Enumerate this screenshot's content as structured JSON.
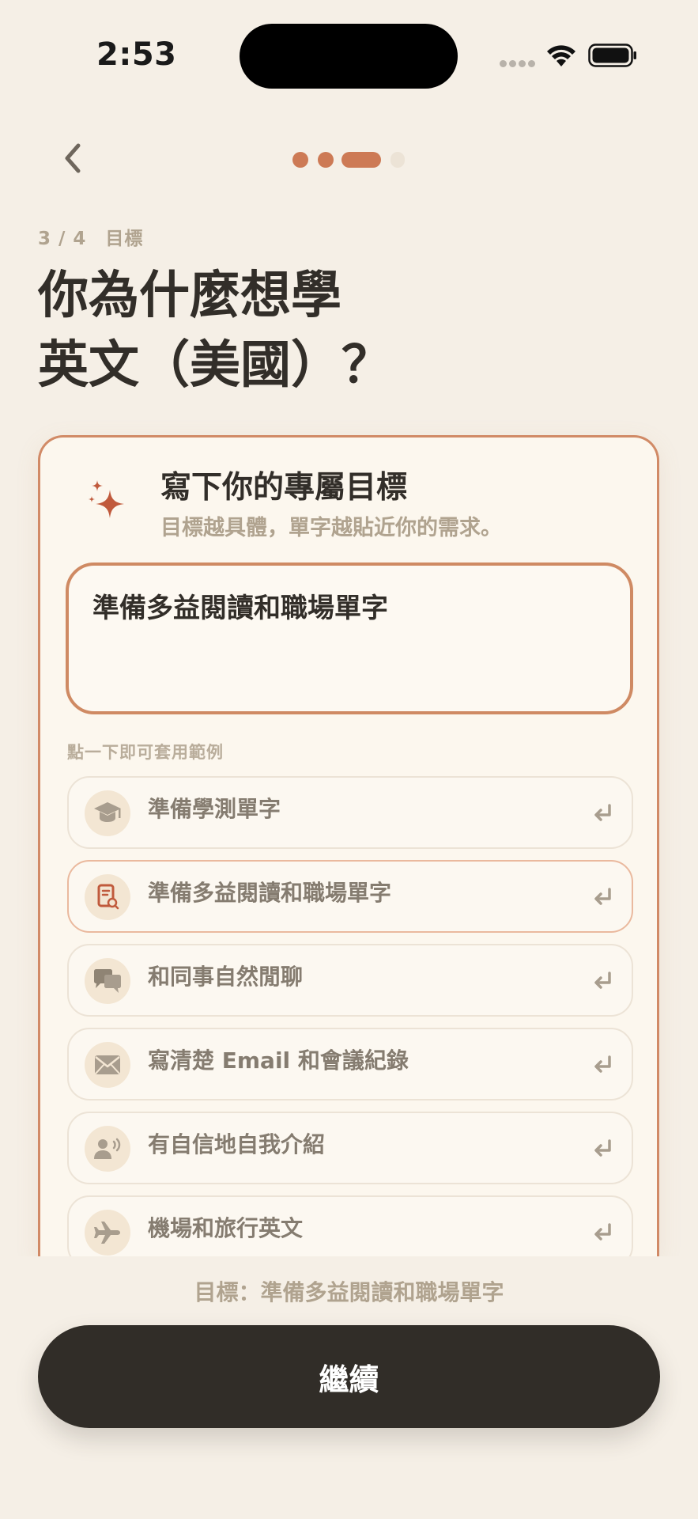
{
  "status_bar": {
    "time": "2:53"
  },
  "progress": {
    "total_steps": 4,
    "current_step": 3
  },
  "header": {
    "step_text": "3 / 4　目標",
    "title_line1": "你為什麼想學",
    "title_line2": "英文（美國）？"
  },
  "card": {
    "title": "寫下你的專屬目標",
    "subtitle": "目標越具體，單字越貼近你的需求。",
    "input_value": "準備多益閱讀和職場單字",
    "hint": "點一下即可套用範例",
    "examples": [
      {
        "label": "準備學測單字",
        "icon": "graduation-cap-icon"
      },
      {
        "label": "準備多益閱讀和職場單字",
        "icon": "document-search-icon"
      },
      {
        "label": "和同事自然閒聊",
        "icon": "chat-bubbles-icon"
      },
      {
        "label": "寫清楚 Email 和會議紀錄",
        "icon": "envelope-icon"
      },
      {
        "label": "有自信地自我介紹",
        "icon": "person-speaking-icon"
      },
      {
        "label": "機場和旅行英文",
        "icon": "airplane-icon"
      }
    ],
    "selected_index": 1
  },
  "footer": {
    "selected_goal": "目標：準備多益閱讀和職場單字",
    "continue_label": "繼續"
  },
  "colors": {
    "accent": "#cd7a55",
    "background": "#f5efe6",
    "button_dark": "#312d28"
  }
}
